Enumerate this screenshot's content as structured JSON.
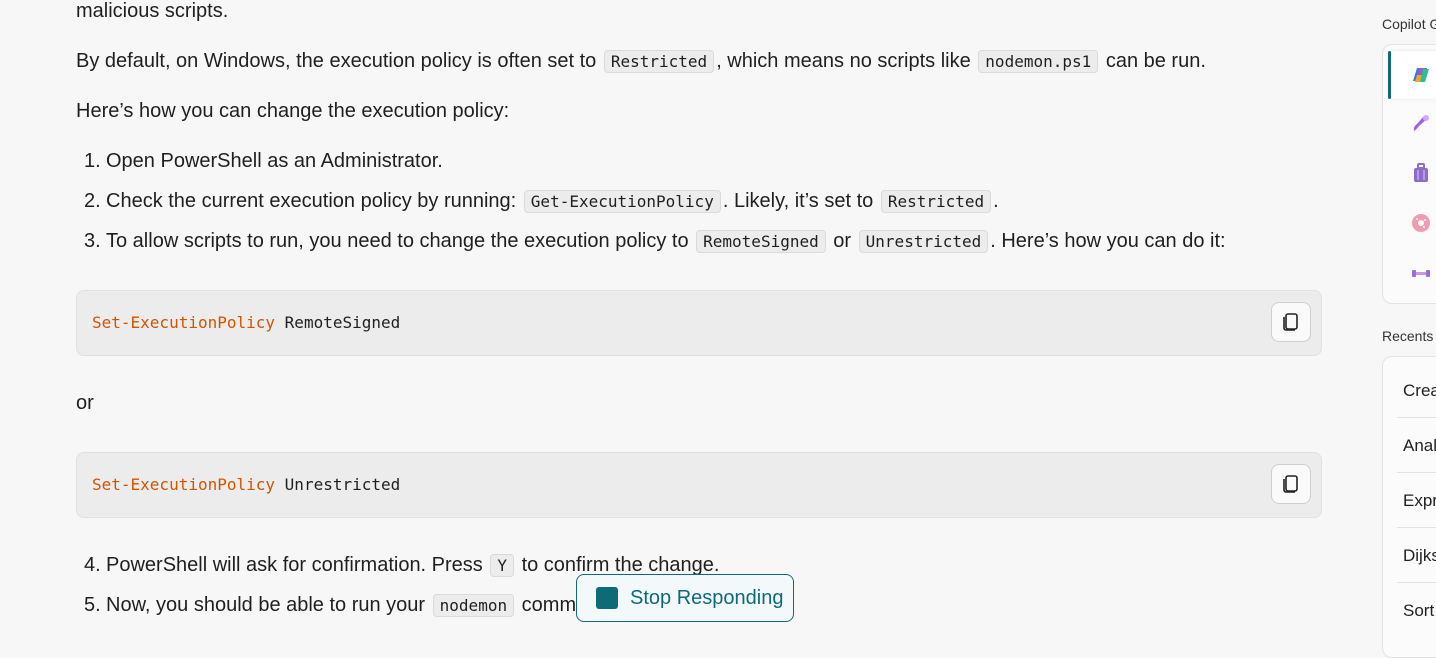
{
  "content": {
    "intro_fragment": "malicious scripts.",
    "para1": {
      "pre": "By default, on Windows, the execution policy is often set to",
      "code1": "Restricted",
      "mid": ", which means no scripts like",
      "code2": "nodemon.ps1",
      "post": "can be run."
    },
    "para2": "Here’s how you can change the execution policy:",
    "steps": [
      {
        "num": "1.",
        "text": "Open PowerShell as an Administrator."
      },
      {
        "num": "2.",
        "pre": "Check the current execution policy by running:",
        "code1": "Get-ExecutionPolicy",
        "mid": ". Likely, it’s set to",
        "code2": "Restricted",
        "post": "."
      },
      {
        "num": "3.",
        "pre": "To allow scripts to run, you need to change the execution policy to",
        "code1": "RemoteSigned",
        "mid": "or",
        "code2": "Unrestricted",
        "post": ". Here’s how you can do it:"
      },
      {
        "num": "4.",
        "pre": "PowerShell will ask for confirmation. Press",
        "code1": "Y",
        "post": "to confirm the change."
      },
      {
        "num": "5.",
        "pre": "Now, you should be able to run your",
        "code1": "nodemon",
        "post": "comma"
      }
    ],
    "code_block_1": {
      "keyword": "Set-ExecutionPolicy",
      "arg": "RemoteSigned"
    },
    "or_text": "or",
    "code_block_2": {
      "keyword": "Set-ExecutionPolicy",
      "arg": "Unrestricted"
    }
  },
  "stop_button": {
    "label": "Stop Responding"
  },
  "sidebar": {
    "title": "Copilot G",
    "gpts": [
      {
        "icon": "copilot-icon"
      },
      {
        "icon": "designer-icon"
      },
      {
        "icon": "vacation-planner-icon"
      },
      {
        "icon": "cooking-icon"
      },
      {
        "icon": "fitness-icon"
      }
    ],
    "recents_title": "Recents",
    "recents": [
      "Crea",
      "Anal",
      "Expr",
      "Dijks",
      "Sort"
    ]
  },
  "colors": {
    "accent": "#0f6a78",
    "keyword": "#d35400"
  }
}
